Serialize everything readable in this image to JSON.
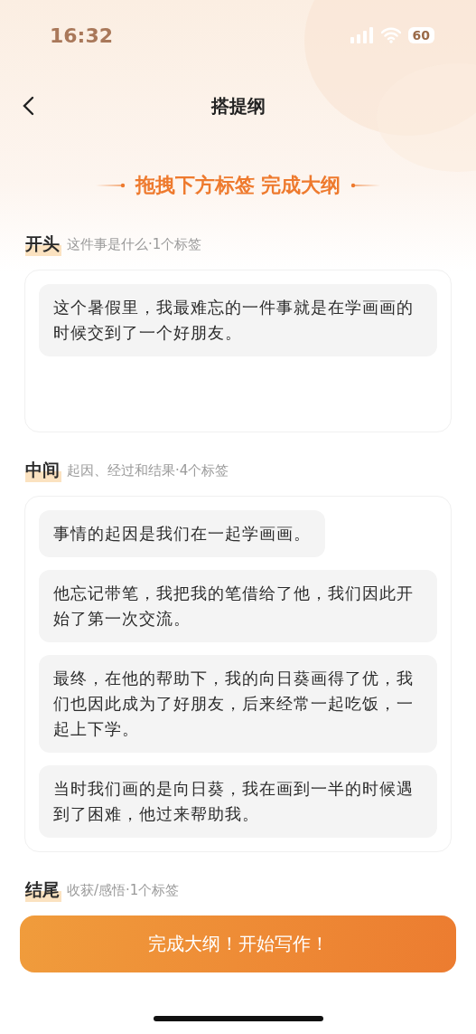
{
  "status_bar": {
    "time": "16:32",
    "battery": "60"
  },
  "nav": {
    "title": "搭提纲"
  },
  "banner": "拖拽下方标签 完成大纲",
  "sections": [
    {
      "title": "开头",
      "subtitle": "这件事是什么·1个标签",
      "tags": [
        "这个暑假里，我最难忘的一件事就是在学画画的时候交到了一个好朋友。"
      ]
    },
    {
      "title": "中间",
      "subtitle": "起因、经过和结果·4个标签",
      "tags": [
        "事情的起因是我们在一起学画画。",
        "他忘记带笔，我把我的笔借给了他，我们因此开始了第一次交流。",
        "最终，在他的帮助下，我的向日葵画得了优，我们也因此成为了好朋友，后来经常一起吃饭，一起上下学。",
        "当时我们画的是向日葵，我在画到一半的时候遇到了困难，他过来帮助我。"
      ]
    },
    {
      "title": "结尾",
      "subtitle": "收获/感悟·1个标签"
    }
  ],
  "button": "完成大纲！开始写作！"
}
